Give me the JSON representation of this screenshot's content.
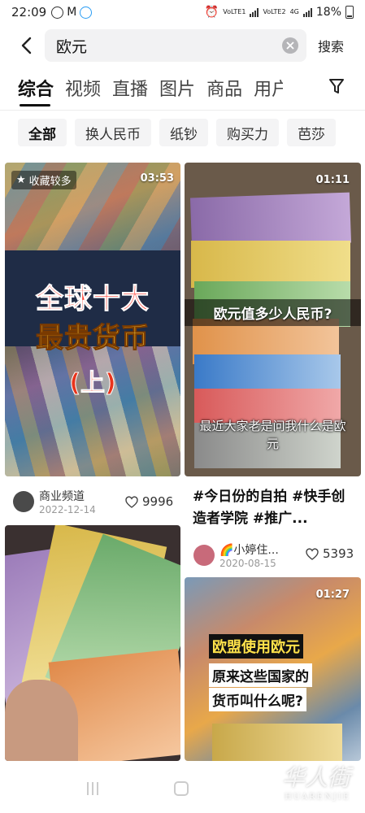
{
  "status": {
    "time": "22:09",
    "sim1": "VoLTE1",
    "sim2": "VoLTE2",
    "net": "4G",
    "battery": "18%"
  },
  "search": {
    "query": "欧元",
    "submit_label": "搜索"
  },
  "tabs": [
    "综合",
    "视频",
    "直播",
    "图片",
    "商品",
    "用户"
  ],
  "chips": [
    "全部",
    "换人民币",
    "纸钞",
    "购买力",
    "芭莎"
  ],
  "feed": {
    "card1": {
      "badge": "收藏较多",
      "duration": "03:53",
      "overlay_line1": "全球十大",
      "overlay_line2": "最贵货币",
      "overlay_line3": "(上)",
      "author": "商业频道",
      "date": "2022-12-14",
      "likes": "9996"
    },
    "card2": {
      "duration": "01:11",
      "overlay_q": "欧元值多少人民币?",
      "overlay_sub": "最近大家老是问我什么是欧元",
      "title": "#今日份的自拍 #快手创造者学院 #推广...",
      "author": "🌈小婷住...",
      "date": "2020-08-15",
      "likes": "5393"
    },
    "card3": {},
    "card4": {
      "duration": "01:27",
      "overlay_line1": "欧盟使用欧元",
      "overlay_line2": "原来这些国家的",
      "overlay_line3": "货币叫什么呢?"
    }
  },
  "watermark": {
    "cn": "华人街",
    "en": "HUARENJIE"
  }
}
